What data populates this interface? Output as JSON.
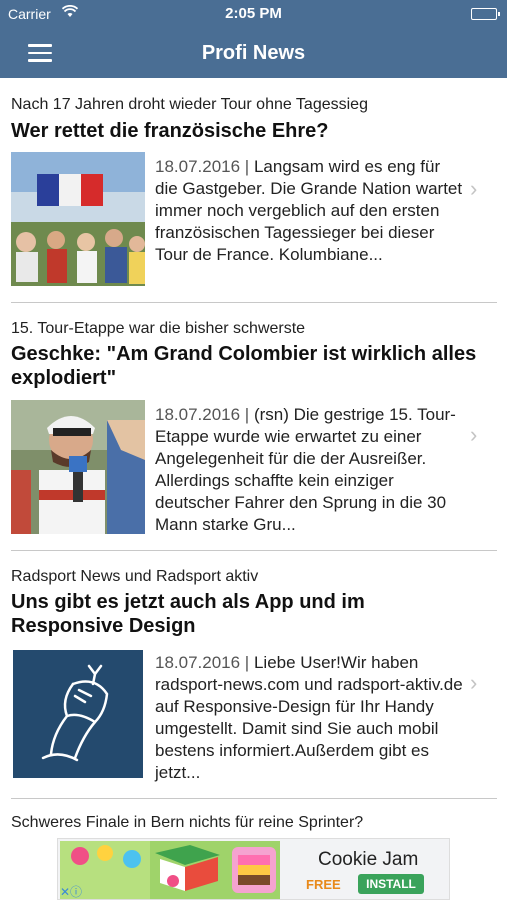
{
  "status_bar": {
    "carrier": "Carrier",
    "time": "2:05 PM"
  },
  "navbar": {
    "title": "Profi News",
    "menu_icon": "hamburger-menu-icon"
  },
  "articles": [
    {
      "kicker": "Nach 17 Jahren droht wieder Tour ohne Tagessieg",
      "headline": "Wer rettet die französische Ehre?",
      "date": "18.07.2016 |",
      "teaser": "Langsam wird es eng für die Gastgeber. Die Grande Nation wartet immer noch vergeblich auf den ersten französischen Tagessieger bei dieser Tour de France. Kolumbiane..."
    },
    {
      "kicker": "15. Tour-Etappe war die bisher schwerste",
      "headline": "Geschke: \"Am Grand Colombier ist wirklich alles explodiert\"",
      "date": "18.07.2016 |",
      "teaser": "(rsn)  Die gestrige 15. Tour-Etappe wurde wie erwartet zu einer Angelegenheit für die der Ausreißer. Allerdings schaffte kein einziger deutscher Fahrer den Sprung in die 30 Mann starke Gru..."
    },
    {
      "kicker": "Radsport News und Radsport aktiv",
      "headline": "Uns gibt es jetzt auch als App und im Responsive Design",
      "date": "18.07.2016 |",
      "teaser": "Liebe User!Wir haben radsport-news.com und radsport-aktiv.de auf Responsive-Design für Ihr Handy umgestellt. Damit sind Sie auch mobil bestens informiert.Außerdem gibt es jetzt..."
    }
  ],
  "next_article": {
    "kicker": "Schweres Finale in Bern nichts für reine Sprinter?"
  },
  "ad": {
    "title": "Cookie Jam",
    "price": "FREE",
    "install": "INSTALL"
  },
  "colors": {
    "navbar": "#4a6e94",
    "separator": "#c8c8c8",
    "chevron": "#c4c4c4"
  }
}
